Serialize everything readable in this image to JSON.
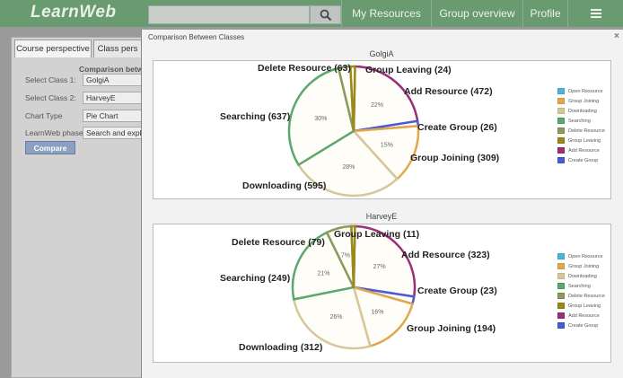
{
  "app": {
    "logo": "LearnWeb"
  },
  "topnav": {
    "items": [
      "My Resources",
      "Group overview",
      "Profile"
    ],
    "menu_icon": "hamburger-icon",
    "search_icon": "search-icon"
  },
  "left_panel": {
    "tabs": [
      "Course perspective",
      "Class pers"
    ],
    "heading": "Comparison betw",
    "fields": [
      {
        "label": "Select Class 1:",
        "value": "GolgiA"
      },
      {
        "label": "Select Class 2:",
        "value": "HarveyE"
      },
      {
        "label": "Chart Type",
        "value": "Pie Chart"
      },
      {
        "label": "LearnWeb phase",
        "value": "Search and explo"
      }
    ],
    "compare_label": "Compare"
  },
  "modal": {
    "title": "Comparison Between Classes",
    "close": "×"
  },
  "legend": [
    "Open Resource",
    "Group Joining",
    "Downloading",
    "Searching",
    "Delete Resource",
    "Group Leaving",
    "Add Resource",
    "Create Group"
  ],
  "colors": {
    "Open Resource": "#4fb3d9",
    "Group Joining": "#e0a84a",
    "Downloading": "#d6c79a",
    "Searching": "#5aa86e",
    "Delete Resource": "#8a9a5b",
    "Group Leaving": "#9a8a1a",
    "Add Resource": "#9b2f7a",
    "Create Group": "#4a5ad8"
  },
  "chart_data": [
    {
      "type": "pie",
      "title": "GolgiA",
      "slices": [
        {
          "label": "Add Resource",
          "value": 472,
          "display": "Add Resource (472)",
          "percent": "22%"
        },
        {
          "label": "Create Group",
          "value": 26,
          "display": "Create Group (26)",
          "percent": ""
        },
        {
          "label": "Group Joining",
          "value": 309,
          "display": "Group Joining (309)",
          "percent": "15%"
        },
        {
          "label": "Downloading",
          "value": 595,
          "display": "Downloading (595)",
          "percent": "28%"
        },
        {
          "label": "Searching",
          "value": 637,
          "display": "Searching (637)",
          "percent": "30%"
        },
        {
          "label": "Delete Resource",
          "value": 63,
          "display": "Delete Resource (63)",
          "percent": ""
        },
        {
          "label": "Group Leaving",
          "value": 24,
          "display": "Group Leaving (24)",
          "percent": ""
        }
      ]
    },
    {
      "type": "pie",
      "title": "HarveyE",
      "slices": [
        {
          "label": "Add Resource",
          "value": 323,
          "display": "Add Resource (323)",
          "percent": "27%"
        },
        {
          "label": "Create Group",
          "value": 23,
          "display": "Create Group (23)",
          "percent": ""
        },
        {
          "label": "Group Joining",
          "value": 194,
          "display": "Group Joining (194)",
          "percent": "16%"
        },
        {
          "label": "Downloading",
          "value": 312,
          "display": "Downloading (312)",
          "percent": "26%"
        },
        {
          "label": "Searching",
          "value": 249,
          "display": "Searching (249)",
          "percent": "21%"
        },
        {
          "label": "Delete Resource",
          "value": 79,
          "display": "Delete Resource (79)",
          "percent": "7%"
        },
        {
          "label": "Group Leaving",
          "value": 11,
          "display": "Group Leaving (11)",
          "percent": ""
        }
      ]
    }
  ]
}
